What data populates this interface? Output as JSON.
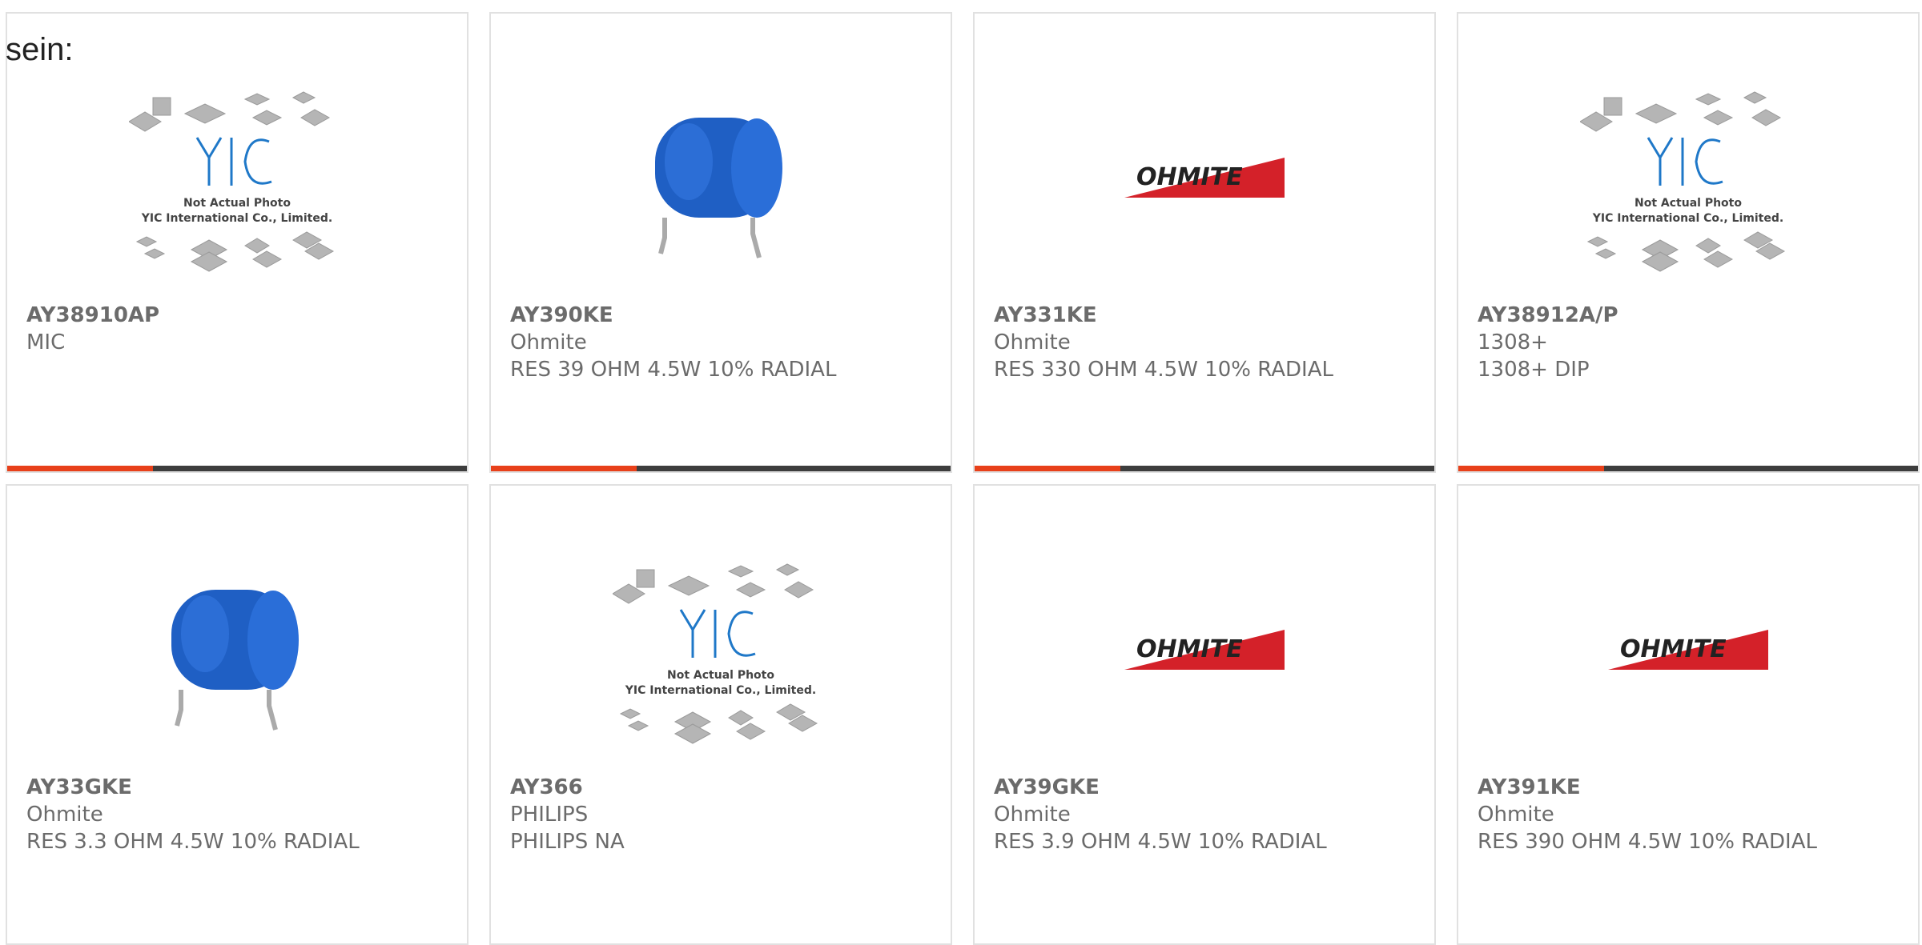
{
  "intro_text": "sein:",
  "brand_colors": {
    "accent_bar": "#e8401a",
    "dark_bar": "#3d3d3d",
    "ohmite_red": "#d42129",
    "yic_blue": "#1f78c8",
    "capacitor_blue": "#1f5fc4"
  },
  "placeholder": {
    "line1": "Not Actual Photo",
    "line2": "YIC International Co., Limited."
  },
  "logo_text": "OHMITE",
  "products": [
    {
      "part": "AY38910AP",
      "maker": "MIC",
      "desc": "",
      "image": "yic-placeholder"
    },
    {
      "part": "AY390KE",
      "maker": "Ohmite",
      "desc": "RES 39 OHM 4.5W 10% RADIAL",
      "image": "blue-resistor"
    },
    {
      "part": "AY331KE",
      "maker": "Ohmite",
      "desc": "RES 330 OHM 4.5W 10% RADIAL",
      "image": "ohmite-logo"
    },
    {
      "part": "AY38912A/P",
      "maker": "1308+",
      "desc": "1308+ DIP",
      "image": "yic-placeholder"
    },
    {
      "part": "AY33GKE",
      "maker": "Ohmite",
      "desc": "RES 3.3 OHM 4.5W 10% RADIAL",
      "image": "blue-resistor"
    },
    {
      "part": "AY366",
      "maker": "PHILIPS",
      "desc": "PHILIPS NA",
      "image": "yic-placeholder"
    },
    {
      "part": "AY39GKE",
      "maker": "Ohmite",
      "desc": "RES 3.9 OHM 4.5W 10% RADIAL",
      "image": "ohmite-logo"
    },
    {
      "part": "AY391KE",
      "maker": "Ohmite",
      "desc": "RES 390 OHM 4.5W 10% RADIAL",
      "image": "ohmite-logo"
    }
  ]
}
